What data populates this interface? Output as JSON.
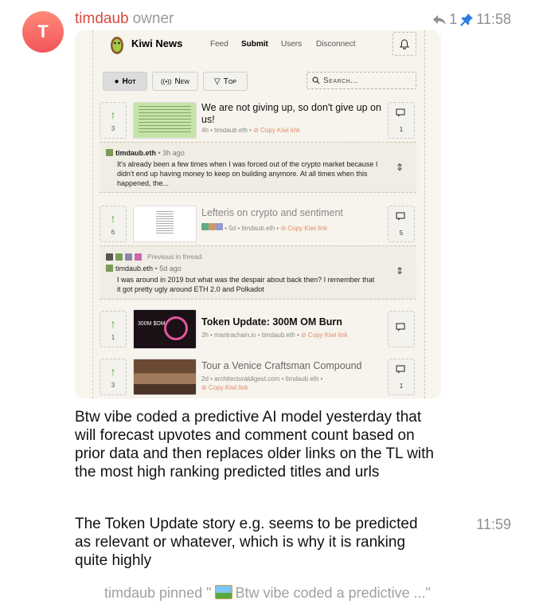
{
  "message": {
    "avatar_letter": "T",
    "sender": "timdaub",
    "role": "owner",
    "reply_count": "1",
    "time": "11:58",
    "paragraphs": [
      "Btw vibe coded a predictive AI model yesterday that will forecast upvotes and comment count based on prior data and then replaces older links on the TL with the most high ranking predicted titles and urls",
      "The Token Update story e.g. seems to be predicted as relevant or whatever, which is why it is ranking quite highly"
    ],
    "second_time": "11:59",
    "pin_user": "timdaub",
    "pin_word": "pinned",
    "pin_quote_open": "\"",
    "pin_text": "Btw vibe coded a predictive ...",
    "pin_quote_close": "\""
  },
  "kiwi": {
    "brand": "Kiwi News",
    "nav": [
      "Feed",
      "Submit",
      "Users",
      "Disconnect"
    ],
    "tabs": [
      "Hot",
      "New",
      "Top"
    ],
    "search_placeholder": "Search...",
    "stories": [
      {
        "title": "We are not giving up, so don't give up on us!",
        "meta": "4h • timdaub.eth • ",
        "copy": "Copy Kiwi link",
        "votes": "3",
        "comments": "1"
      },
      {
        "title": "Lefteris on crypto and sentiment",
        "meta": "• 5d • timdaub.eth • ",
        "copy": "Copy Kiwi link",
        "votes": "6",
        "comments": "5"
      },
      {
        "title": "Token Update: 300M OM Burn",
        "meta": "3h • mantrachain.io • timdaub.eth • ",
        "copy": "Copy Kiwi link",
        "votes": "1",
        "comments": ""
      },
      {
        "title": "Tour a Venice Craftsman Compound",
        "meta": "2d • architecturaldigest.com • timdaub.eth • ",
        "copy": "Copy Kiwi link",
        "votes": "3",
        "comments": "1"
      }
    ],
    "previews": [
      {
        "user": "timdaub.eth",
        "ago": "• 3h ago",
        "text": "It's already been a few times when I was forced out of the crypto market because I didn't end up having money to keep on building anymore. At all times when this happened, the..."
      },
      {
        "label": "Previous in thread",
        "user": "timdaub.eth",
        "ago": "• 5d ago",
        "text": "I was around in 2019 but what was the despair about back then? I remember that it got pretty ugly around ETH 2.0 and Polkadot"
      }
    ],
    "thumb_text": "300M $OM"
  }
}
